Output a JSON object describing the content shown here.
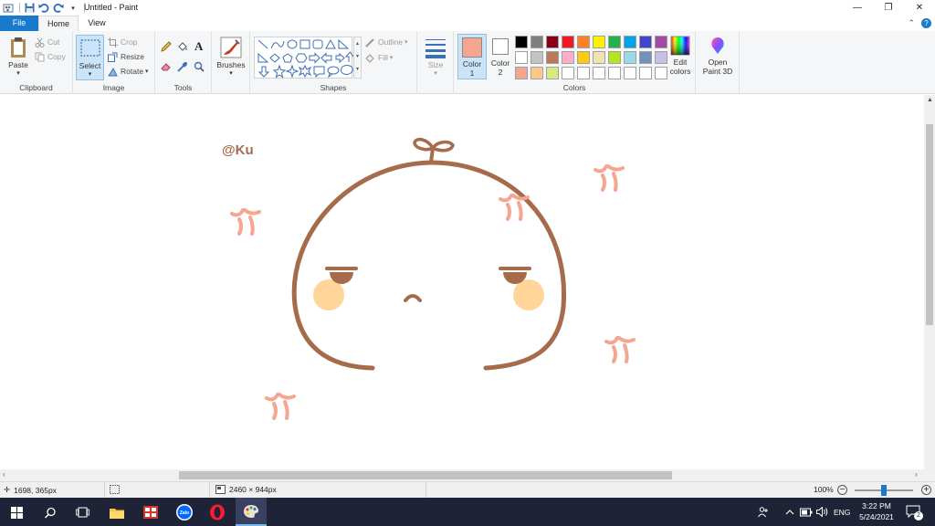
{
  "window": {
    "title": "Untitled - Paint",
    "controls": {
      "minimize": "—",
      "restore": "❐",
      "close": "✕"
    },
    "help_glyph": "?",
    "collapse_glyph": "⌃"
  },
  "tabs": [
    {
      "label": "File"
    },
    {
      "label": "Home"
    },
    {
      "label": "View"
    }
  ],
  "ribbon": {
    "clipboard": {
      "label": "Clipboard",
      "paste": "Paste",
      "cut": "Cut",
      "copy": "Copy"
    },
    "image": {
      "label": "Image",
      "select": "Select",
      "crop": "Crop",
      "resize": "Resize",
      "rotate": "Rotate"
    },
    "tools": {
      "label": "Tools"
    },
    "brushes": {
      "label": "Brushes"
    },
    "shapes": {
      "label": "Shapes",
      "outline": "Outline",
      "fill": "Fill"
    },
    "size": {
      "label": "Size"
    },
    "colors": {
      "label": "Colors",
      "color1": {
        "label": "Color",
        "num": "1",
        "value": "#f5a691"
      },
      "color2": {
        "label": "Color",
        "num": "2",
        "value": "#ffffff"
      },
      "edit_colors": "Edit colors",
      "palette_row1": [
        "#000000",
        "#7f7f7f",
        "#880015",
        "#ed1c24",
        "#ff7f27",
        "#fff200",
        "#22b14c",
        "#00a2e8",
        "#3f48cc",
        "#a349a4"
      ],
      "palette_row2": [
        "#ffffff",
        "#c3c3c3",
        "#b97a57",
        "#ffaec9",
        "#ffc90e",
        "#efe4b0",
        "#b5e61d",
        "#99d9ea",
        "#7092be",
        "#c8bfe7"
      ],
      "palette_row3": [
        "#f5a691",
        "#ffc78c",
        "#d6ea80",
        "#ffffff",
        "#ffffff",
        "#ffffff",
        "#ffffff",
        "#ffffff",
        "#ffffff",
        "#ffffff"
      ]
    },
    "paint3d": {
      "label": "Open Paint 3D"
    }
  },
  "canvas": {
    "signature": "@Ku",
    "ink_color": "#a56b4b",
    "accent_color": "#f5a691"
  },
  "status": {
    "cursor_pos": "1698, 365px",
    "canvas_size": "2460 × 944px",
    "zoom": "100%",
    "zoom_level": 0.5
  },
  "taskbar": {
    "zalo_label": "Zalo",
    "language": "ENG",
    "time": "3:22 PM",
    "date": "5/24/2021",
    "notification_count": "2"
  }
}
